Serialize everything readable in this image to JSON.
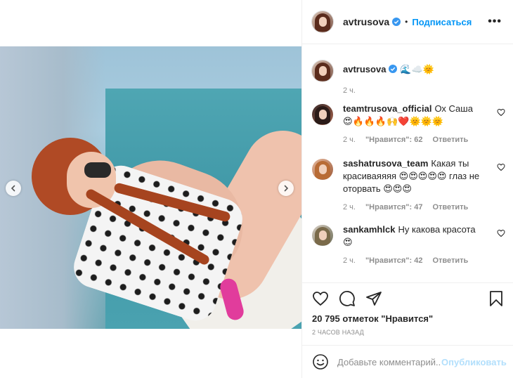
{
  "post": {
    "username": "avtrusova",
    "follow_label": "Подписаться",
    "separator": "•",
    "more_label": "•••",
    "caption_text": "🌊☁️🌞",
    "caption_time": "2 ч."
  },
  "comments": [
    {
      "username": "teamtrusova_official",
      "text": "Ох Саша",
      "line2": "😍🔥🔥🔥🙌❤️🌞🌞🌞",
      "time": "2 ч.",
      "likes": "\"Нравится\": 62",
      "reply": "Ответить"
    },
    {
      "username": "sashatrusova_team",
      "text": "Какая ты красиваяяяя 😍😍😍😍😍 глаз не оторвать 😍😍😍",
      "time": "2 ч.",
      "likes": "\"Нравится\": 47",
      "reply": "Ответить"
    },
    {
      "username": "sankamhlck",
      "text": "Ну какова красота",
      "line2": "😍",
      "time": "2 ч.",
      "likes": "\"Нравится\": 42",
      "reply": "Ответить"
    }
  ],
  "stats": {
    "likes": "20 795 отметок \"Нравится\"",
    "time_ago": "2 часов назад"
  },
  "add_comment": {
    "placeholder": "Добавьте комментарий...",
    "publish_label": "Опубликовать"
  },
  "colors": {
    "accent": "#0095f6",
    "publish_disabled": "#b2dffc",
    "muted": "#8e8e8e",
    "text": "#262626"
  },
  "icons": [
    "chevron-left-icon",
    "chevron-right-icon",
    "verified-icon",
    "more-icon",
    "heart-icon",
    "comment-icon",
    "share-icon",
    "bookmark-icon",
    "smile-icon"
  ]
}
